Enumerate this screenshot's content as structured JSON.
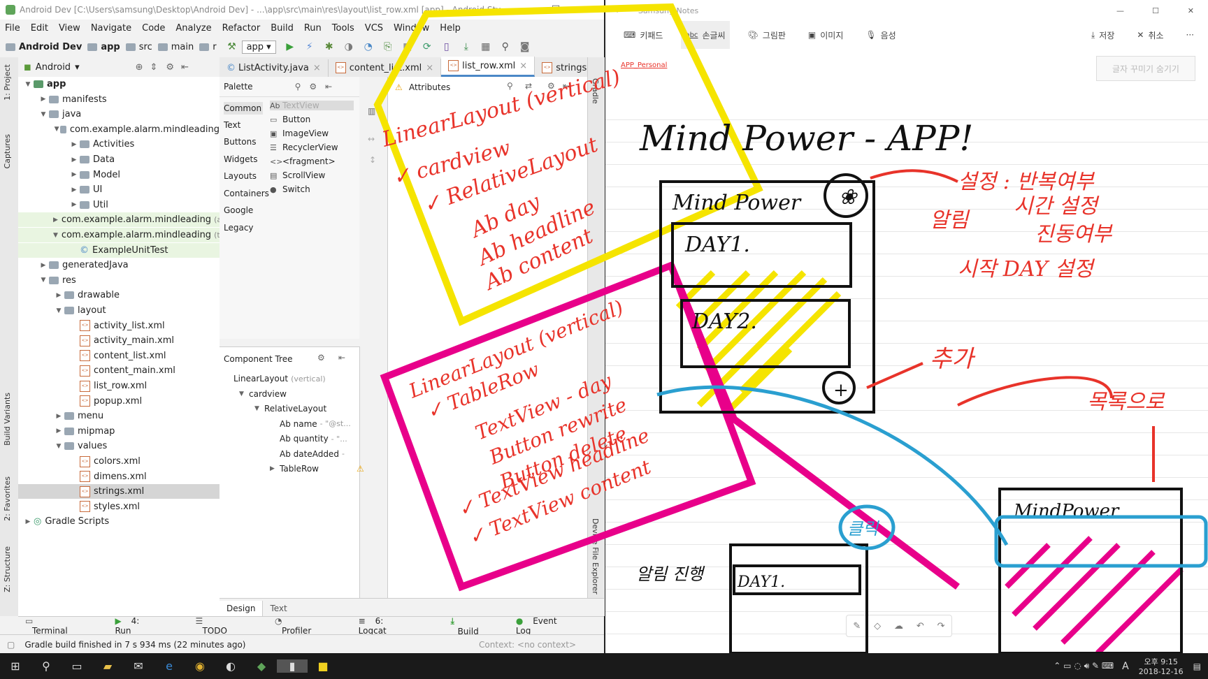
{
  "android_studio": {
    "window_title": "Android Dev [C:\\Users\\samsung\\Desktop\\Android Dev] - ...\\app\\src\\main\\res\\layout\\list_row.xml [app] - Android Stu...",
    "menu": [
      "File",
      "Edit",
      "View",
      "Navigate",
      "Code",
      "Analyze",
      "Refactor",
      "Build",
      "Run",
      "Tools",
      "VCS",
      "Window",
      "Help"
    ],
    "breadcrumb": [
      "Android Dev",
      "app",
      "src",
      "main",
      "r"
    ],
    "run_config": "app",
    "project_view": "Android",
    "tree": [
      {
        "label": "app",
        "depth": 0,
        "open": true,
        "type": "module"
      },
      {
        "label": "manifests",
        "depth": 1,
        "open": false,
        "type": "folder"
      },
      {
        "label": "java",
        "depth": 1,
        "open": true,
        "type": "folder"
      },
      {
        "label": "com.example.alarm.mindleading",
        "depth": 2,
        "open": true,
        "type": "folder"
      },
      {
        "label": "Activities",
        "depth": 3,
        "open": false,
        "type": "folder"
      },
      {
        "label": "Data",
        "depth": 3,
        "open": false,
        "type": "folder"
      },
      {
        "label": "Model",
        "depth": 3,
        "open": false,
        "type": "folder"
      },
      {
        "label": "UI",
        "depth": 3,
        "open": false,
        "type": "folder"
      },
      {
        "label": "Util",
        "depth": 3,
        "open": false,
        "type": "folder"
      },
      {
        "label": "com.example.alarm.mindleading",
        "suffix": "(ar",
        "depth": 2,
        "open": false,
        "type": "folder",
        "hl": true
      },
      {
        "label": "com.example.alarm.mindleading",
        "suffix": "(te",
        "depth": 2,
        "open": true,
        "type": "folder",
        "hl": true
      },
      {
        "label": "ExampleUnitTest",
        "depth": 3,
        "type": "class",
        "hl": true
      },
      {
        "label": "generatedJava",
        "depth": 1,
        "open": false,
        "type": "folder"
      },
      {
        "label": "res",
        "depth": 1,
        "open": true,
        "type": "folder"
      },
      {
        "label": "drawable",
        "depth": 2,
        "open": false,
        "type": "folder"
      },
      {
        "label": "layout",
        "depth": 2,
        "open": true,
        "type": "folder"
      },
      {
        "label": "activity_list.xml",
        "depth": 3,
        "type": "xml"
      },
      {
        "label": "activity_main.xml",
        "depth": 3,
        "type": "xml"
      },
      {
        "label": "content_list.xml",
        "depth": 3,
        "type": "xml"
      },
      {
        "label": "content_main.xml",
        "depth": 3,
        "type": "xml"
      },
      {
        "label": "list_row.xml",
        "depth": 3,
        "type": "xml"
      },
      {
        "label": "popup.xml",
        "depth": 3,
        "type": "xml"
      },
      {
        "label": "menu",
        "depth": 2,
        "open": false,
        "type": "folder"
      },
      {
        "label": "mipmap",
        "depth": 2,
        "open": false,
        "type": "folder"
      },
      {
        "label": "values",
        "depth": 2,
        "open": true,
        "type": "folder"
      },
      {
        "label": "colors.xml",
        "depth": 3,
        "type": "xml"
      },
      {
        "label": "dimens.xml",
        "depth": 3,
        "type": "xml"
      },
      {
        "label": "strings.xml",
        "depth": 3,
        "type": "xml",
        "sel": true
      },
      {
        "label": "styles.xml",
        "depth": 3,
        "type": "xml"
      },
      {
        "label": "Gradle Scripts",
        "depth": 0,
        "open": false,
        "type": "gradle"
      }
    ],
    "tabs": [
      {
        "label": "ListActivity.java",
        "active": false
      },
      {
        "label": "content_list.xml",
        "active": false
      },
      {
        "label": "list_row.xml",
        "active": true
      },
      {
        "label": "strings.xml",
        "active": false
      }
    ],
    "palette": {
      "title": "Palette",
      "categories": [
        "Common",
        "Text",
        "Buttons",
        "Widgets",
        "Layouts",
        "Containers",
        "Google",
        "Legacy"
      ],
      "items": [
        {
          "icon": "Ab",
          "label": "TextView"
        },
        {
          "icon": "▭",
          "label": "Button"
        },
        {
          "icon": "▣",
          "label": "ImageView"
        },
        {
          "icon": "☰",
          "label": "RecyclerView"
        },
        {
          "icon": "<>",
          "label": "<fragment>"
        },
        {
          "icon": "▤",
          "label": "ScrollView"
        },
        {
          "icon": "●",
          "label": "Switch"
        }
      ]
    },
    "attributes_title": "Attributes",
    "component_tree": {
      "title": "Component Tree",
      "rows": [
        {
          "label": "LinearLayout",
          "hint": "(vertical)",
          "depth": 0
        },
        {
          "label": "cardview",
          "hint": "",
          "depth": 1,
          "open": true
        },
        {
          "label": "RelativeLayout",
          "hint": "",
          "depth": 2,
          "open": true
        },
        {
          "label": "Ab name",
          "hint": "- \"@st...",
          "depth": 3
        },
        {
          "label": "Ab quantity",
          "hint": "- \"...",
          "depth": 3
        },
        {
          "label": "Ab dateAdded",
          "hint": "-",
          "depth": 3
        },
        {
          "label": "TableRow",
          "hint": "",
          "depth": 3,
          "open": false,
          "warn": true
        }
      ]
    },
    "design_tabs": [
      "Design",
      "Text"
    ],
    "bottom_tools": [
      "Terminal",
      "4: Run",
      "TODO",
      "Profiler",
      "6: Logcat",
      "Build"
    ],
    "event_log": "Event Log",
    "status": "Gradle build finished in 7 s 934 ms (22 minutes ago)",
    "context": "Context: <no context>",
    "left_tool_tabs": [
      "1: Project",
      "Captures",
      "Build Variants",
      "2: Favorites",
      "Z: Structure"
    ],
    "right_tool_tabs": [
      "Gradle",
      "Device File Explorer"
    ]
  },
  "samsung_notes": {
    "title": "Samsung Notes",
    "tools": [
      "키패드",
      "손글씨",
      "그림판",
      "이미지",
      "음성"
    ],
    "save": "저장",
    "cancel": "취소",
    "more": "···",
    "hide_btn": "글자 꾸미기 숨기기",
    "category": "APP_Personal",
    "float_tools": [
      "✎",
      "◇",
      "☁",
      "↶",
      "↷"
    ]
  },
  "taskbar": {
    "time": "오후 9:15",
    "date": "2018-12-16",
    "ime": "A"
  },
  "annotations": {
    "yellow_note": [
      "LinearLayout (vertical)",
      "✓ cardview",
      "✓ RelativeLayout",
      "Ab day",
      "Ab headline",
      "Ab content"
    ],
    "magenta_note": [
      "LinearLayout (vertical)",
      "✓ TableRow",
      "TextView - day",
      "Button rewrite",
      "Button delete",
      "✓ TextView headline",
      "✓ TextView content"
    ],
    "sketch_title": "Mind Power - APP!",
    "sketch_app_name": "Mind Power",
    "sketch_days": [
      "DAY1.",
      "DAY2."
    ],
    "red_settings": "설정 : 반복여부",
    "red_alarm": "알림",
    "red_alarm_time": "시간 설정",
    "red_vibrate": "진동여부",
    "red_start": "시작 DAY 설정",
    "red_add": "추가",
    "red_list": "목록으로",
    "blue_click": "클릭",
    "alarm_note": "알림 진행",
    "small_day": "DAY1.",
    "small_app_name": "MindPower",
    "colors": {
      "yellow": "#f5e400",
      "magenta": "#e8008a",
      "red": "#e8332a",
      "blue": "#2a9fd0",
      "ink": "#111111"
    }
  }
}
